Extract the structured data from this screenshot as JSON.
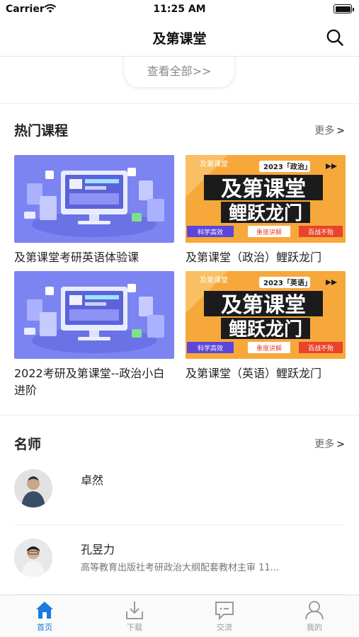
{
  "status_bar": {
    "carrier": "Carrier",
    "time": "11:25 AM"
  },
  "nav": {
    "title": "及第课堂",
    "search_icon": "search-icon"
  },
  "view_all": {
    "label": "查看全部>>"
  },
  "hot_courses": {
    "title": "热门课程",
    "more_label": "更多",
    "more_arrow": ">",
    "items": [
      {
        "title": "及第课堂考研英语体验课",
        "thumb": "computer-illustration"
      },
      {
        "title": "及第课堂（政治）鲤跃龙门",
        "thumb": "poster",
        "poster": {
          "brand": "及第课堂",
          "badge": "2023「政治」",
          "line1": "及第课堂",
          "line2": "鲤跃龙门",
          "tag1": "科学高效",
          "tag2": "重度讲解",
          "tag3": "百战不殆"
        }
      },
      {
        "title": "2022考研及第课堂--政治小白进阶",
        "thumb": "computer-illustration"
      },
      {
        "title": "及第课堂（英语）鲤跃龙门",
        "thumb": "poster",
        "poster": {
          "brand": "及第课堂",
          "badge": "2023「英语」",
          "line1": "及第课堂",
          "line2": "鲤跃龙门",
          "tag1": "科学高效",
          "tag2": "重度讲解",
          "tag3": "百战不殆"
        }
      }
    ]
  },
  "teachers": {
    "title": "名师",
    "more_label": "更多",
    "more_arrow": ">",
    "items": [
      {
        "name": "卓然",
        "desc": ""
      },
      {
        "name": "孔昱力",
        "desc": "高等教育出版社考研政治大纲配套教材主审 11..."
      }
    ]
  },
  "tab_bar": {
    "items": [
      {
        "label": "首页",
        "icon": "home-icon",
        "active": true
      },
      {
        "label": "下载",
        "icon": "download-icon",
        "active": false
      },
      {
        "label": "交流",
        "icon": "chat-icon",
        "active": false
      },
      {
        "label": "我的",
        "icon": "profile-icon",
        "active": false
      }
    ]
  },
  "colors": {
    "accent": "#1a7be0",
    "poster_orange": "#f7a83a",
    "illustration_purple": "#7c84f2"
  }
}
